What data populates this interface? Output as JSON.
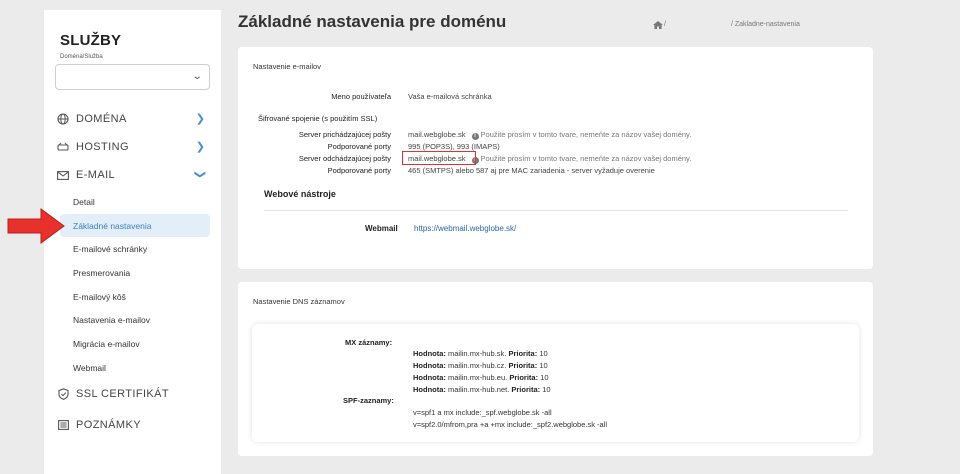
{
  "sidebar": {
    "brand": "SLUŽBY",
    "brand_sub": "Doména/Služba",
    "select_value": "",
    "nav": [
      {
        "label": "DOMÉNA"
      },
      {
        "label": "HOSTING"
      },
      {
        "label": "E-MAIL"
      }
    ],
    "sub_items": [
      {
        "label": "Detail"
      },
      {
        "label": "Základné nastavenia"
      },
      {
        "label": "E-mailové schránky"
      },
      {
        "label": "Presmerovania"
      },
      {
        "label": "E-mailový kôš"
      },
      {
        "label": "Nastavenia e-mailov"
      },
      {
        "label": "Migrácia e-mailov"
      },
      {
        "label": "Webmail"
      }
    ],
    "nav_bottom": [
      {
        "label": "SSL CERTIFIKÁT"
      },
      {
        "label": "POZNÁMKY"
      }
    ]
  },
  "header": {
    "title": "Základné nastavenia pre doménu",
    "crumb_home_sep": "/",
    "crumb_tail": "/ Zakladne-nastavenia"
  },
  "email_card": {
    "title": "Nastavenie e-mailov",
    "user_label": "Meno používateľa",
    "user_value": "Vaša e-mailová schránka",
    "ssl_heading": "Šifrované spojenie (s použitím SSL)",
    "incoming_label": "Server prichádzajúcej pošty",
    "incoming_value": "mail.webglobe.sk",
    "incoming_note": "Použite prosím v tomto tvare, nemeňte za názov vašej domény.",
    "incoming_ports_label": "Podporované porty",
    "incoming_ports_value": "995 (POP3S), 993 (IMAPS)",
    "outgoing_label": "Server odchádzajúcej pošty",
    "outgoing_value": "mail.webglobe.sk",
    "outgoing_note": "Použite prosím v tomto tvare, nemeňte za názov vašej domény.",
    "outgoing_ports_label": "Podporované porty",
    "outgoing_ports_value": "465 (SMTPS) alebo 587 aj pre MAC zariadenia - server vyžaduje overenie",
    "tools_heading": "Webové nástroje",
    "webmail_label": "Webmail",
    "webmail_link": "https://webmail.webglobe.sk/"
  },
  "dns_card": {
    "title": "Nastavenie DNS záznamov",
    "mx_label": "MX záznamy:",
    "hodnota_label": "Hodnota:",
    "priorita_label": "Priorita:",
    "mx_records": [
      {
        "host": "mailin.mx-hub.sk.",
        "priority": "10"
      },
      {
        "host": "mailin.mx-hub.cz.",
        "priority": "10"
      },
      {
        "host": "mailin.mx-hub.eu.",
        "priority": "10"
      },
      {
        "host": "mailin.mx-hub.net.",
        "priority": "10"
      }
    ],
    "spf_label": "SPF-zaznamy:",
    "spf_records": [
      "v=spf1 a mx include:_spf.webglobe.sk -all",
      "v=spf2.0/mfrom,pra +a +mx include:_spf2.webglobe.sk -all"
    ]
  },
  "colors": {
    "accent": "#4a90c8",
    "active_bg": "#e3eef9",
    "highlight": "#e0302f",
    "link": "#2b68a8"
  }
}
